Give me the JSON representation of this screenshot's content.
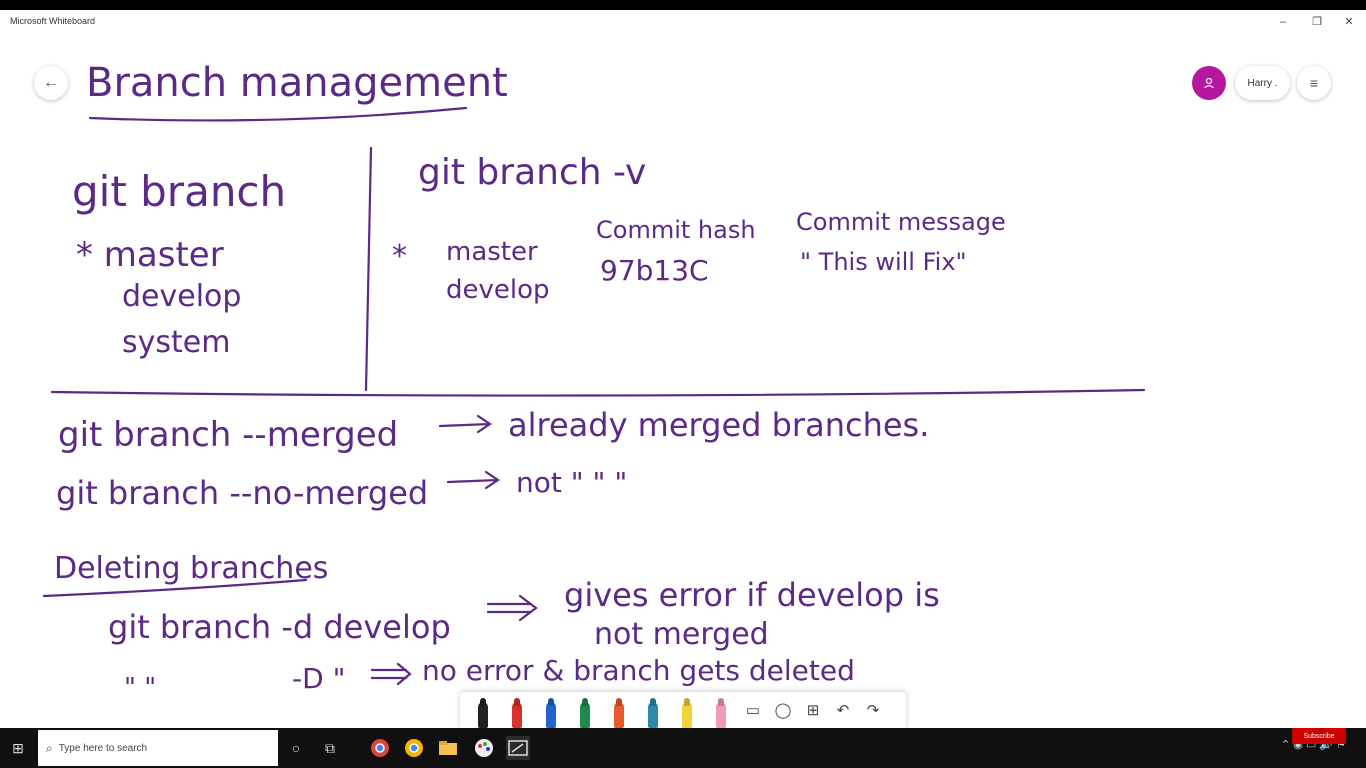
{
  "window": {
    "title": "Microsoft Whiteboard",
    "minimize": "–",
    "maximize": "❐",
    "close": "✕"
  },
  "header": {
    "back_icon": "←",
    "user_name": "Harry .",
    "menu_icon": "≡"
  },
  "whiteboard": {
    "heading": "Branch management",
    "left_command": "git branch",
    "left_items": [
      "* master",
      "develop",
      "system"
    ],
    "right_command": "git branch -v",
    "right_star": "*",
    "right_branches": [
      "master",
      "develop"
    ],
    "hash_label": "Commit hash",
    "hash_value": "97b13C",
    "msg_label": "Commit message",
    "msg_value": "\" This will Fix\"",
    "merged_cmd": "git branch --merged",
    "merged_desc": "already merged branches.",
    "nomerged_cmd": "git branch --no-merged",
    "nomerged_desc": "not  \"    \"      \"",
    "deleting_heading": "Deleting branches",
    "delete_cmd": "git branch -d develop",
    "delete_desc_1": "gives error if develop is",
    "delete_desc_2": "not merged",
    "force_ditto": "\"      \"",
    "force_cmd": "-D \"",
    "force_desc": "no error & branch gets deleted"
  },
  "toolbar": {
    "pens": [
      {
        "name": "black-pen",
        "color": "#222222"
      },
      {
        "name": "red-pen",
        "color": "#d9312b"
      },
      {
        "name": "blue-pen",
        "color": "#2266cc"
      },
      {
        "name": "green-pen",
        "color": "#1f8a4c"
      },
      {
        "name": "orange-pen",
        "color": "#e65a2b"
      },
      {
        "name": "teal-pen",
        "color": "#2a8aa8"
      },
      {
        "name": "yellow-highlighter",
        "color": "#f2d13a"
      },
      {
        "name": "pink-eraser",
        "color": "#f29bb8"
      }
    ],
    "ruler_icon": "▭",
    "lasso_icon": "◯",
    "add_icon": "⊞",
    "undo_icon": "↶",
    "redo_icon": "↷"
  },
  "taskbar": {
    "start_icon": "⊞",
    "search_placeholder": "Type here to search",
    "cortana_icon": "○",
    "task_view_icon": "⧉",
    "subscribe_label": "Subscribe"
  }
}
